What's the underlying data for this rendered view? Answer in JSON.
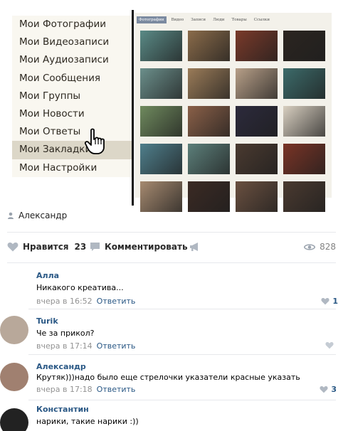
{
  "menu": {
    "items": [
      {
        "label": "Мои Фотографии"
      },
      {
        "label": "Мои Видеозаписи"
      },
      {
        "label": "Мои Аудиозаписи"
      },
      {
        "label": "Мои Сообщения"
      },
      {
        "label": "Мои Группы"
      },
      {
        "label": "Мои Новости"
      },
      {
        "label": "Мои Ответы"
      },
      {
        "label": "Мои Закладки"
      },
      {
        "label": "Мои Настройки"
      }
    ],
    "active_index": 7
  },
  "gallery": {
    "tabs": [
      "Фотографии",
      "Видео",
      "Записи",
      "Люди",
      "Товары",
      "Ссылки"
    ],
    "thumb_colors": [
      "#5a8a86",
      "#8a6b4a",
      "#7a3a2a",
      "#2b2520",
      "#6b8f8b",
      "#9a7b58",
      "#b79f88",
      "#3c6b6a",
      "#6f8a5e",
      "#8a6048",
      "#2c2a3c",
      "#d8cfc0",
      "#4f7f8c",
      "#5c7f7a",
      "#4a3a30",
      "#7a3426",
      "#a68a70",
      "#3b2a24",
      "#6a5040",
      "#4a3a30"
    ]
  },
  "author": {
    "name": "Александр"
  },
  "actions": {
    "like_label": "Нравится",
    "like_count": "23",
    "comment_label": "Комментировать",
    "views": "828"
  },
  "comments": [
    {
      "author": "Алла",
      "text": "Никакого креатива...",
      "time": "вчера в 16:52",
      "reply": "Ответить",
      "likes": "1",
      "avatar_color": "#ffffff"
    },
    {
      "author": "Turik",
      "text": "Че за прикол?",
      "time": "вчера в 17:14",
      "reply": "Ответить",
      "likes": "",
      "avatar_color": "#b8a89a"
    },
    {
      "author": "Александр",
      "text": "Крутяк)))надо было еще стрелочки указатели красные указать",
      "time": "вчера в 17:18",
      "reply": "Ответить",
      "likes": "3",
      "avatar_color": "#a08070"
    },
    {
      "author": "Константин",
      "text": "нарики, такие нарики :))",
      "time": "",
      "reply": "",
      "likes": "",
      "avatar_color": "#222222"
    }
  ]
}
